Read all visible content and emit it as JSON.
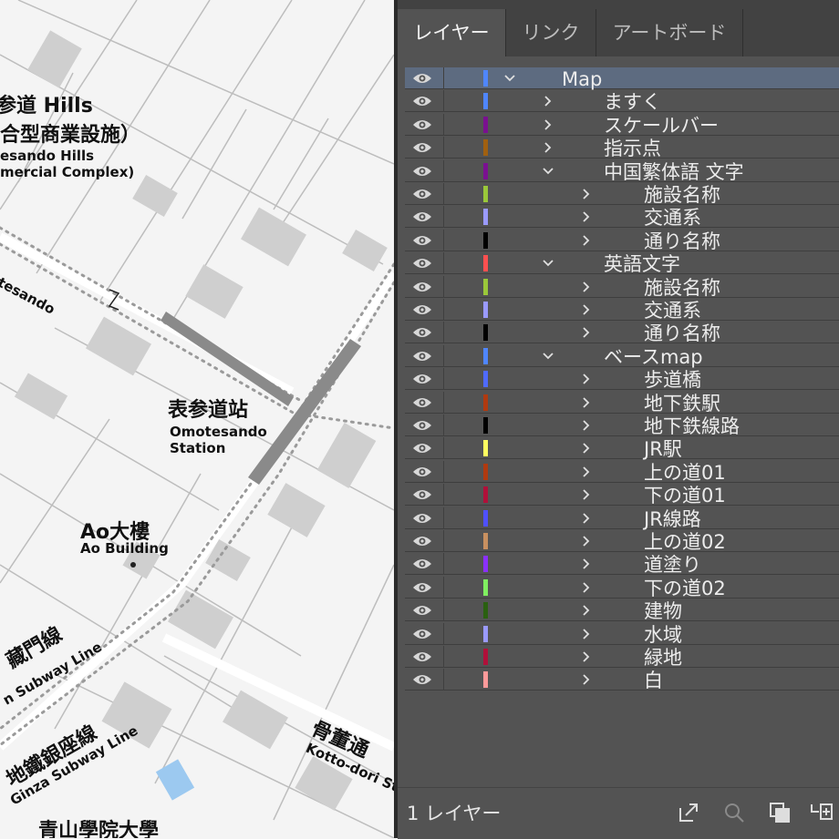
{
  "map": {
    "labels": [
      {
        "id": "hills_ja",
        "text": "参道 Hills",
        "cls": "ja"
      },
      {
        "id": "hills_ja2",
        "text": "合型商業設施）",
        "cls": "ja"
      },
      {
        "id": "hills_en",
        "text": "esando Hills",
        "cls": "en"
      },
      {
        "id": "hills_en2",
        "text": "mercial Complex)",
        "cls": "en"
      },
      {
        "id": "omotesando_road",
        "text": "otesando",
        "cls": "en"
      },
      {
        "id": "station_ja",
        "text": "表参道站",
        "cls": "ja"
      },
      {
        "id": "station_en",
        "text": "Omotesando",
        "cls": "en"
      },
      {
        "id": "station_en2",
        "text": "Station",
        "cls": "en"
      },
      {
        "id": "ao_ja",
        "text": "Ao大樓",
        "cls": "ja"
      },
      {
        "id": "ao_en",
        "text": "Ao Building",
        "cls": "en"
      },
      {
        "id": "hanzomon_ja",
        "text": "藏門線",
        "cls": "ja"
      },
      {
        "id": "hanzomon_en",
        "text": "n Subway Line",
        "cls": "en"
      },
      {
        "id": "ginza_ja",
        "text": "地鐵銀座線",
        "cls": "ja"
      },
      {
        "id": "ginza_en",
        "text": "Ginza Subway Line",
        "cls": "en"
      },
      {
        "id": "kotto_ja",
        "text": "骨董通",
        "cls": "ja"
      },
      {
        "id": "kotto_en",
        "text": "Kotto-dori St",
        "cls": "en"
      },
      {
        "id": "aoyama_ja",
        "text": "青山學院大學",
        "cls": "ja"
      }
    ]
  },
  "panel": {
    "tabs": [
      {
        "label": "レイヤー",
        "active": true
      },
      {
        "label": "リンク",
        "active": false
      },
      {
        "label": "アートボード",
        "active": false
      }
    ],
    "layers": [
      {
        "name": "Map",
        "color": "#4f86ff",
        "depth": 0,
        "expanded": true,
        "selected": true
      },
      {
        "name": "ますく",
        "color": "#4f86ff",
        "depth": 1,
        "expanded": false
      },
      {
        "name": "スケールバー",
        "color": "#7a1090",
        "depth": 1,
        "expanded": false
      },
      {
        "name": "指示点",
        "color": "#a06010",
        "depth": 1,
        "expanded": false
      },
      {
        "name": "中国繁体語 文字",
        "color": "#7a1090",
        "depth": 1,
        "expanded": true
      },
      {
        "name": "施設名称",
        "color": "#9ac83a",
        "depth": 2,
        "expanded": false
      },
      {
        "name": "交通系",
        "color": "#9a9aff",
        "depth": 2,
        "expanded": false
      },
      {
        "name": "通り名称",
        "color": "#000000",
        "depth": 2,
        "expanded": false
      },
      {
        "name": "英語文字",
        "color": "#ff5050",
        "depth": 1,
        "expanded": true
      },
      {
        "name": "施設名称",
        "color": "#9ac83a",
        "depth": 2,
        "expanded": false
      },
      {
        "name": "交通系",
        "color": "#9a9aff",
        "depth": 2,
        "expanded": false
      },
      {
        "name": "通り名称",
        "color": "#000000",
        "depth": 2,
        "expanded": false
      },
      {
        "name": "ベースmap",
        "color": "#4f86ff",
        "depth": 1,
        "expanded": true
      },
      {
        "name": "歩道橋",
        "color": "#4f6aff",
        "depth": 2,
        "expanded": false
      },
      {
        "name": "地下鉄駅",
        "color": "#b03a10",
        "depth": 2,
        "expanded": false
      },
      {
        "name": "地下鉄線路",
        "color": "#000000",
        "depth": 2,
        "expanded": false
      },
      {
        "name": "JR駅",
        "color": "#ffff60",
        "depth": 2,
        "expanded": false
      },
      {
        "name": "上の道01",
        "color": "#b03a10",
        "depth": 2,
        "expanded": false
      },
      {
        "name": "下の道01",
        "color": "#b0103a",
        "depth": 2,
        "expanded": false
      },
      {
        "name": "JR線路",
        "color": "#4f50ff",
        "depth": 2,
        "expanded": false
      },
      {
        "name": "上の道02",
        "color": "#c89060",
        "depth": 2,
        "expanded": false
      },
      {
        "name": "道塗り",
        "color": "#8a30ff",
        "depth": 2,
        "expanded": false
      },
      {
        "name": "下の道02",
        "color": "#80f060",
        "depth": 2,
        "expanded": false
      },
      {
        "name": "建物",
        "color": "#2a6010",
        "depth": 2,
        "expanded": false
      },
      {
        "name": "水域",
        "color": "#9a9aff",
        "depth": 2,
        "expanded": false
      },
      {
        "name": "緑地",
        "color": "#b0103a",
        "depth": 2,
        "expanded": false
      },
      {
        "name": "白",
        "color": "#ff9a9a",
        "depth": 2,
        "expanded": false
      }
    ],
    "footer": {
      "layer_count": "1 レイヤー",
      "icons": [
        "export-icon",
        "search-icon",
        "clipping-mask-icon",
        "new-sublayer-icon"
      ]
    }
  }
}
